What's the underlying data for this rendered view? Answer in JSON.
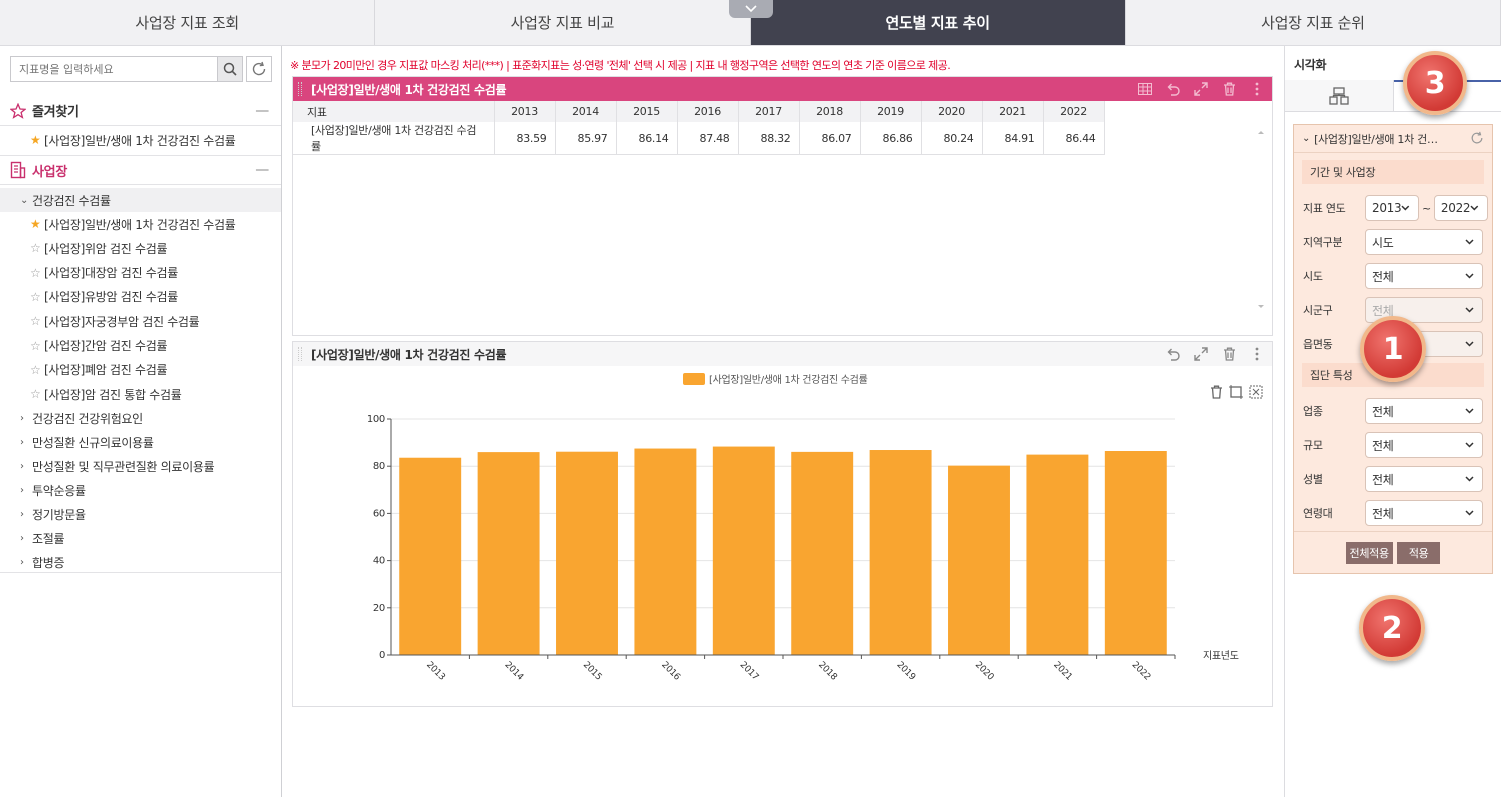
{
  "topnav": {
    "tabs": [
      "사업장 지표 조회",
      "사업장 지표 비교",
      "연도별 지표 추이",
      "사업장 지표 순위"
    ]
  },
  "sidebar": {
    "search_placeholder": "지표명을 입력하세요",
    "favorites_label": "즐겨찾기",
    "favorites": [
      "[사업장]일반/생애 1차 건강검진 수검률"
    ],
    "workplace_label": "사업장",
    "group_open": "건강검진 수검률",
    "group_items": [
      {
        "label": "[사업장]일반/생애 1차 건강검진 수검률",
        "starred": true
      },
      {
        "label": "[사업장]위암 검진 수검률",
        "starred": false
      },
      {
        "label": "[사업장]대장암 검진 수검률",
        "starred": false
      },
      {
        "label": "[사업장]유방암 검진 수검률",
        "starred": false
      },
      {
        "label": "[사업장]자궁경부암 검진 수검률",
        "starred": false
      },
      {
        "label": "[사업장]간암 검진 수검률",
        "starred": false
      },
      {
        "label": "[사업장]폐암 검진 수검률",
        "starred": false
      },
      {
        "label": "[사업장]암 검진 통합 수검률",
        "starred": false
      }
    ],
    "collapsed_groups": [
      "건강검진 건강위험요인",
      "만성질환 신규의료이용률",
      "만성질환 및 직무관련질환 의료이용률",
      "투약순응률",
      "정기방문율",
      "조절률",
      "합병증"
    ]
  },
  "notice": "※ 분모가 20미만인 경우 지표값 마스킹 처리(***) | 표준화지표는 성·연령 '전체' 선택 시 제공 | 지표 내 행정구역은 선택한 연도의 연초 기준 이름으로 제공.",
  "table_panel": {
    "title": "[사업장]일반/생애 1차 건강검진 수검률",
    "header_first": "지표",
    "years": [
      "2013",
      "2014",
      "2015",
      "2016",
      "2017",
      "2018",
      "2019",
      "2020",
      "2021",
      "2022"
    ],
    "row_name": "[사업장]일반/생애 1차 건강검진 수검률",
    "row_values": [
      "83.59",
      "85.97",
      "86.14",
      "87.48",
      "88.32",
      "86.07",
      "86.86",
      "80.24",
      "84.91",
      "86.44"
    ]
  },
  "chart_panel": {
    "title": "[사업장]일반/생애 1차 건강검진 수검률"
  },
  "chart_data": {
    "type": "bar",
    "categories": [
      "2013",
      "2014",
      "2015",
      "2016",
      "2017",
      "2018",
      "2019",
      "2020",
      "2021",
      "2022"
    ],
    "series": [
      {
        "name": "[사업장]일반/생애 1차 건강검진 수검률",
        "values": [
          83.59,
          85.97,
          86.14,
          87.48,
          88.32,
          86.07,
          86.86,
          80.24,
          84.91,
          86.44
        ]
      }
    ],
    "xlabel": "지표년도",
    "ylabel": "",
    "ylim": [
      0,
      100
    ],
    "yticks": [
      "0",
      "20",
      "40",
      "60",
      "80",
      "100"
    ],
    "grid": true,
    "legend_position": "top",
    "color": "#f9a530"
  },
  "right_panel": {
    "title": "시각화",
    "filter_title": "[사업장]일반/생애 1차 건…",
    "section1": "기간 및 사업장",
    "year_label": "지표 연도",
    "year_from": "2013",
    "year_sep": "~",
    "year_to": "2022",
    "rows1": [
      {
        "label": "지역구분",
        "value": "시도",
        "disabled": false
      },
      {
        "label": "시도",
        "value": "전체",
        "disabled": false
      },
      {
        "label": "시군구",
        "value": "전체",
        "disabled": true
      },
      {
        "label": "읍면동",
        "value": "전체",
        "disabled": true
      }
    ],
    "section2": "집단 특성",
    "rows2": [
      {
        "label": "업종",
        "value": "전체"
      },
      {
        "label": "규모",
        "value": "전체"
      },
      {
        "label": "성별",
        "value": "전체"
      },
      {
        "label": "연령대",
        "value": "전체"
      }
    ],
    "btn_apply_all": "전체적용",
    "btn_apply": "적용"
  },
  "badges": [
    "1",
    "2",
    "3"
  ]
}
